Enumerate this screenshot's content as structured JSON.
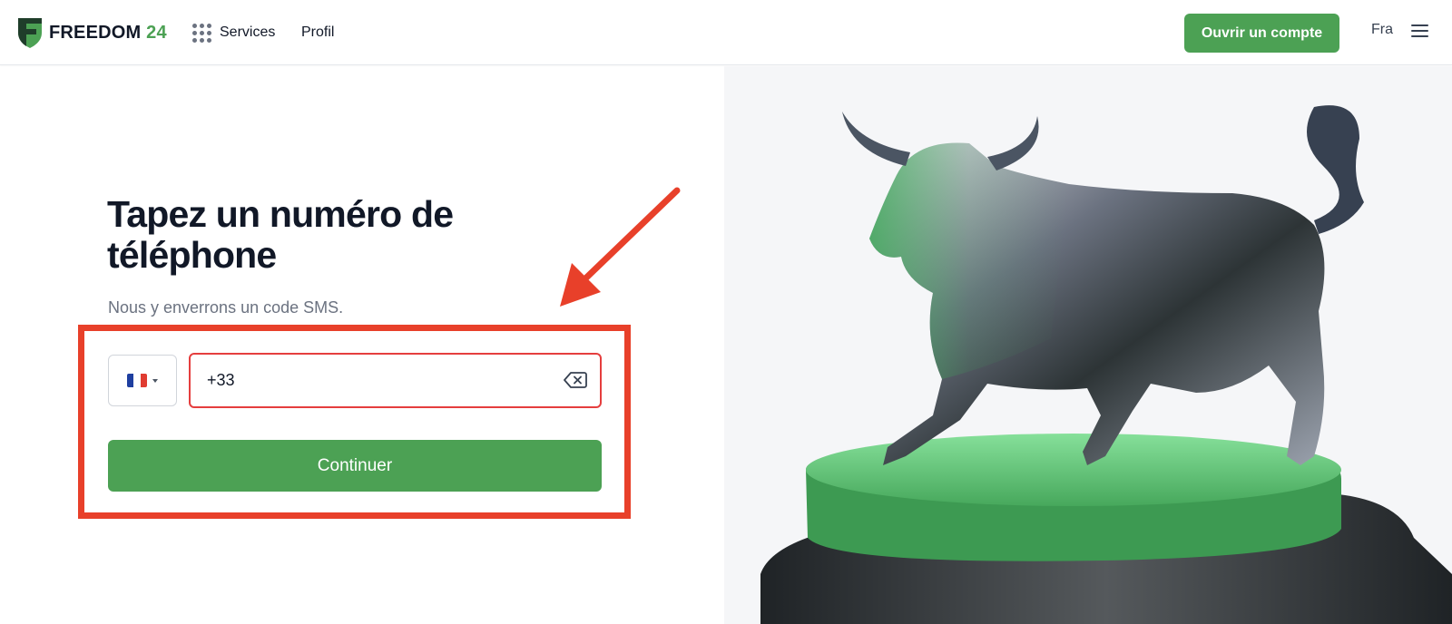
{
  "header": {
    "logo": {
      "word": "FREEDOM",
      "number": "24",
      "icon": "shield-logo"
    },
    "nav": [
      {
        "label": "Services",
        "icon": "apps-grid-icon"
      },
      {
        "label": "Profil"
      }
    ],
    "open_account_label": "Ouvrir un compte",
    "language": "Fra",
    "menu_icon": "hamburger-menu-icon"
  },
  "form": {
    "title": "Tapez un numéro de téléphone",
    "subtitle": "Nous y enverrons un code SMS.",
    "country": {
      "flag": "FR",
      "icon": "france-flag-icon"
    },
    "phone_value": "+33",
    "clear_icon": "backspace-clear-icon",
    "continue_label": "Continuer"
  },
  "annotation": {
    "highlight_color": "#E8402A",
    "arrow_icon": "red-arrow-pointer-icon"
  },
  "hero": {
    "image": "silver-bull-statue-on-green-pedestal"
  },
  "colors": {
    "brand_green": "#4CA154",
    "error_red": "#E53E3E",
    "text_dark": "#111827",
    "text_muted": "#6b7280"
  }
}
